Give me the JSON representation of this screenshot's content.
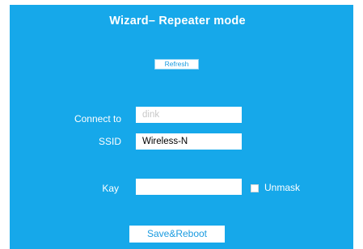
{
  "wizard": {
    "title": "Wizard– Repeater mode",
    "refresh_label": "Refresh"
  },
  "form": {
    "connect_to": {
      "label": "Connect to",
      "value": "dink",
      "disabled": true
    },
    "ssid": {
      "label": "SSID",
      "value": "Wireless-N"
    },
    "key": {
      "label": "Kay",
      "value": ""
    },
    "unmask": {
      "label": "Unmask",
      "checked": false
    }
  },
  "actions": {
    "save_label": "Save&Reboot"
  },
  "colors": {
    "panel_background": "#16a8ea",
    "button_text": "#1a9be0"
  }
}
